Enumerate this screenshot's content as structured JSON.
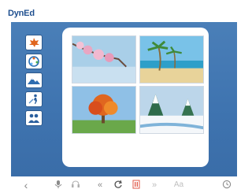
{
  "app": {
    "logo": "DynEd"
  },
  "sidebar": {
    "items": [
      {
        "icon": "autumn-leaf-icon"
      },
      {
        "icon": "seasons-cycle-icon"
      },
      {
        "icon": "weather-icon"
      },
      {
        "icon": "person-activity-icon"
      },
      {
        "icon": "people-icon"
      }
    ]
  },
  "main": {
    "photos": [
      {
        "icon": "spring-blossom-photo"
      },
      {
        "icon": "summer-beach-photo"
      },
      {
        "icon": "autumn-tree-photo"
      },
      {
        "icon": "winter-snow-photo"
      }
    ]
  },
  "toolbar": {
    "back": "‹",
    "rewind": "«",
    "forward": "»",
    "text_size": "Aa"
  },
  "colors": {
    "stage": "#3f74b0",
    "logo": "#1f4f8f",
    "toolbar_icon": "#8a8a8a",
    "accent_red": "#e05a4a"
  }
}
